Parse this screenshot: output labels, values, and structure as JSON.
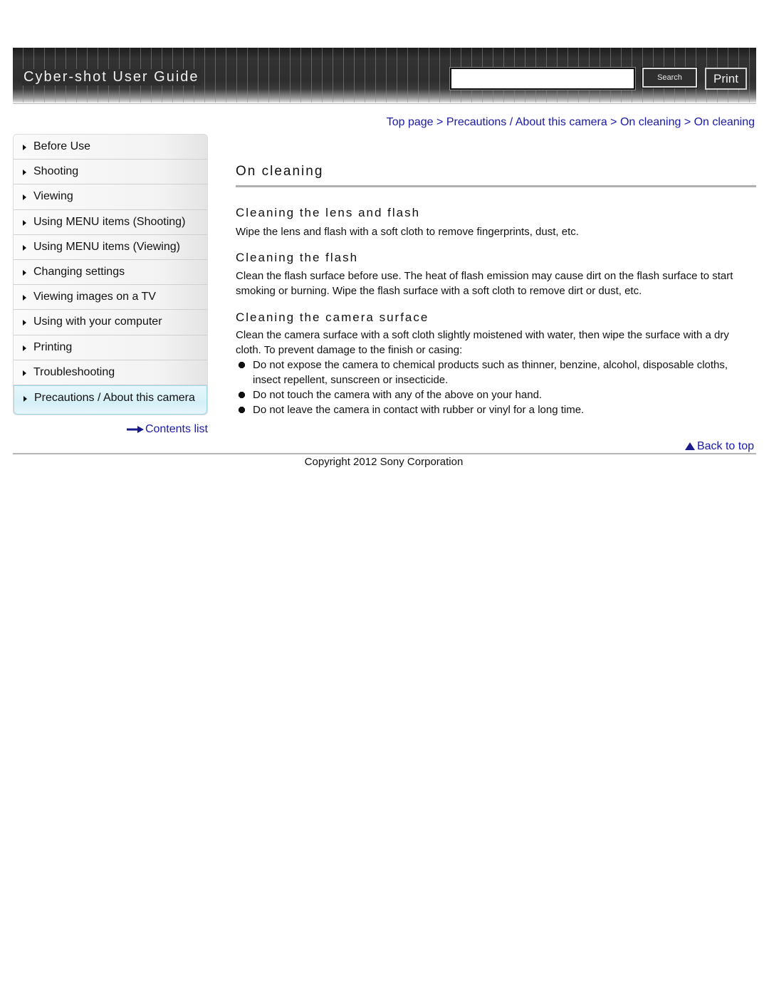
{
  "header": {
    "title": "Cyber-shot User Guide",
    "search_placeholder": "",
    "search_value": "",
    "search_label": "Search",
    "print_label": "Print"
  },
  "breadcrumb": {
    "items": [
      "Top page",
      "Precautions / About this camera",
      "On cleaning",
      "On cleaning"
    ],
    "separator": ">"
  },
  "sidebar": {
    "items": [
      {
        "label": "Before Use"
      },
      {
        "label": "Shooting"
      },
      {
        "label": "Viewing"
      },
      {
        "label": "Using MENU items (Shooting)"
      },
      {
        "label": "Using MENU items (Viewing)"
      },
      {
        "label": "Changing settings"
      },
      {
        "label": "Viewing images on a TV"
      },
      {
        "label": "Using with your computer"
      },
      {
        "label": "Printing"
      },
      {
        "label": "Troubleshooting"
      },
      {
        "label": "Precautions / About this camera",
        "active": true
      }
    ],
    "contents_link": "Contents list"
  },
  "main": {
    "title": "On cleaning",
    "sections": [
      {
        "heading": "Cleaning the lens and flash",
        "text": "Wipe the lens and flash with a soft cloth to remove fingerprints, dust, etc."
      },
      {
        "heading": "Cleaning the flash",
        "text": "Clean the flash surface before use. The heat of flash emission may cause dirt on the flash surface to start smoking or burning. Wipe the flash surface with a soft cloth to remove dirt or dust, etc."
      },
      {
        "heading": "Cleaning the camera surface",
        "text": "Clean the camera surface with a soft cloth slightly moistened with water, then wipe the surface with a dry cloth. To prevent damage to the finish or casing:",
        "bullets": [
          "Do not expose the camera to chemical products such as thinner, benzine, alcohol, disposable cloths, insect repellent, sunscreen or insecticide.",
          "Do not touch the camera with any of the above on your hand.",
          "Do not leave the camera in contact with rubber or vinyl for a long time."
        ]
      }
    ]
  },
  "footer": {
    "back_to_top": "Back to top",
    "copyright": "Copyright 2012 Sony Corporation"
  },
  "colors": {
    "link": "#1a1aa6",
    "header_bg": "#2e2e2e",
    "active_nav_bg": "#d6f0f7"
  }
}
